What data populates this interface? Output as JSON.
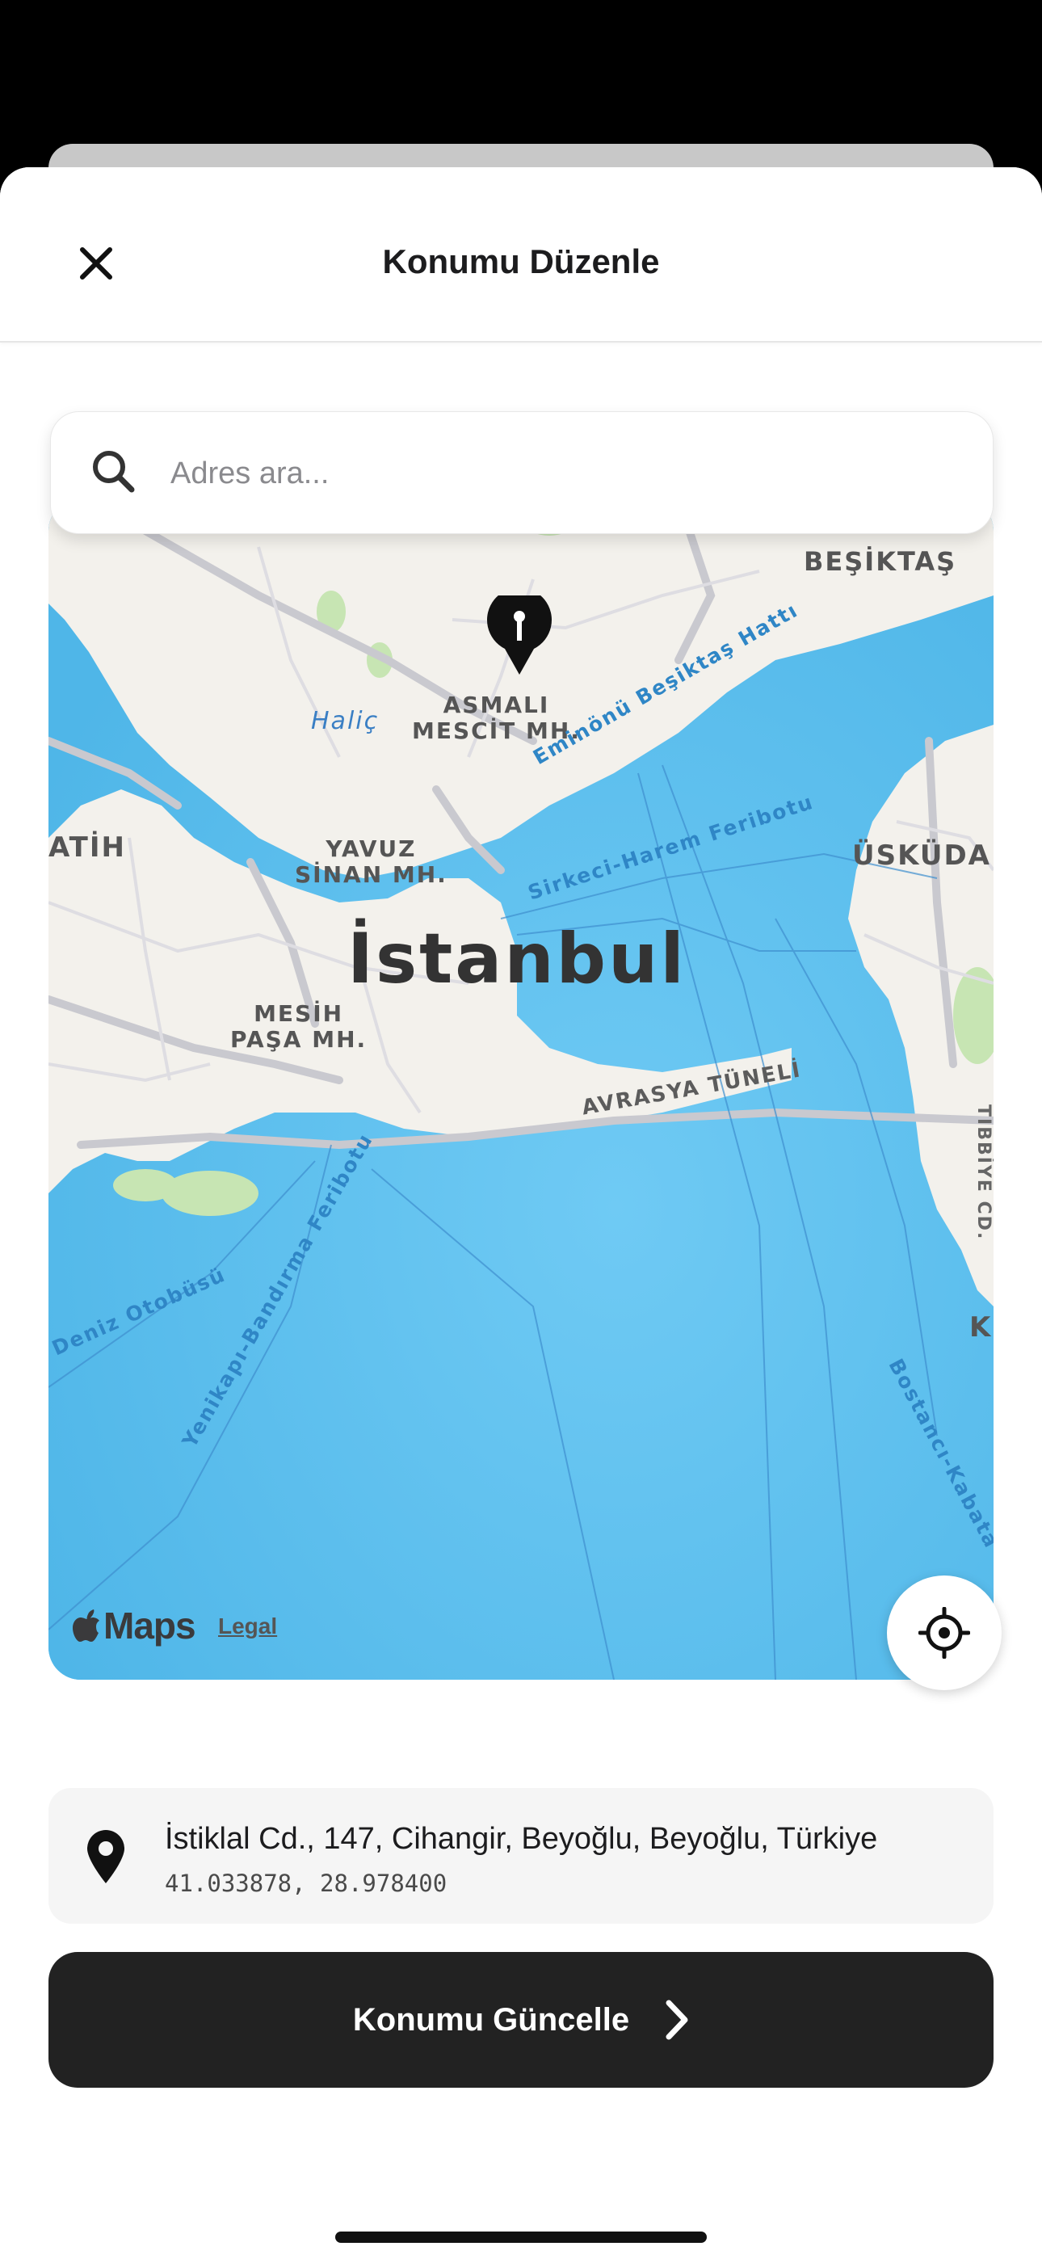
{
  "header": {
    "title": "Konumu Düzenle",
    "close_icon": "close-icon"
  },
  "search": {
    "placeholder": "Adres ara...",
    "icon": "search-icon"
  },
  "map": {
    "labels": {
      "besiktas": "BEŞİKTAŞ",
      "uskudar": "ÜSKÜDAR",
      "fatih": "ATİH",
      "asmali": "ASMALI\nMESCİT MH.",
      "yavuz": "YAVUZ\nSİNAN MH.",
      "mesih": "MESİH\nPAŞA MH.",
      "istanbul": "İstanbul",
      "halic": "Haliç",
      "eminonu": "Eminönü Beşiktaş Hattı",
      "sirkeci": "Sirkeci-Harem Feribotu",
      "avrasya": "AVRASYA TÜNELİ",
      "deniz": "Deniz Otobüsü",
      "yenikapi": "Yenikapı-Bandırma Feribotu",
      "bostanci": "Bostancı-Kabata",
      "tibbiye": "TIBBİYE CD.",
      "k": "K"
    },
    "attribution": {
      "logo": "Maps",
      "legal": "Legal"
    },
    "locate_icon": "crosshair-icon",
    "pin_icon": "map-pin-icon"
  },
  "address": {
    "line": "İstiklal Cd., 147, Cihangir, Beyoğlu, Beyoğlu, Türkiye",
    "coords": "41.033878, 28.978400",
    "icon": "location-pin-icon"
  },
  "action": {
    "label": "Konumu Güncelle",
    "icon": "chevron-right-icon"
  },
  "colors": {
    "water": "#5ec2f0",
    "land": "#f3f1ec",
    "button": "#222222",
    "card": "#f5f5f5"
  }
}
